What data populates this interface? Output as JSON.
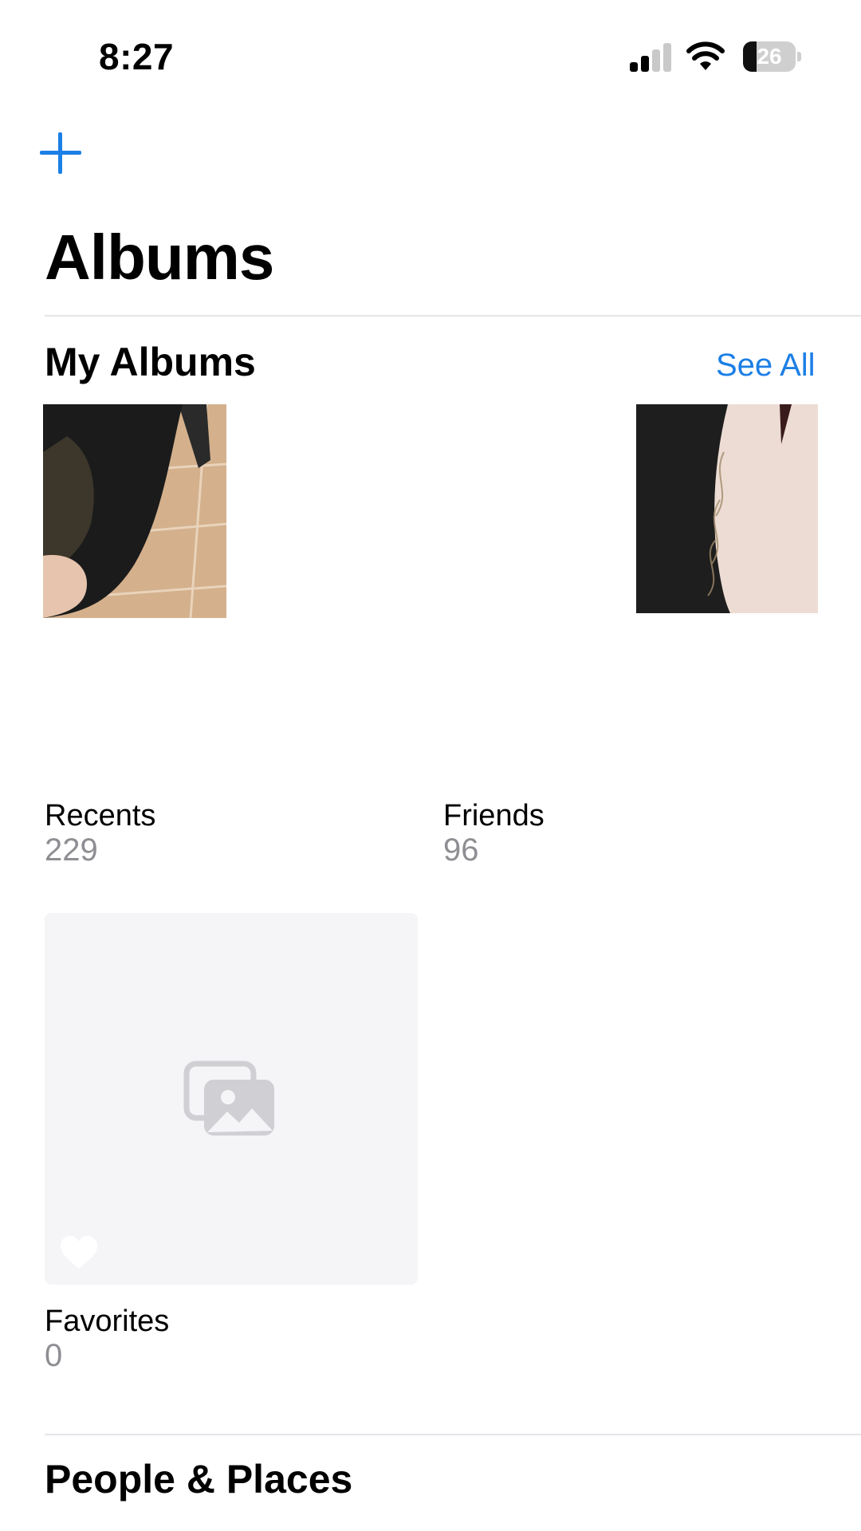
{
  "status_bar": {
    "time": "8:27",
    "battery_level": "26",
    "battery_fraction": 0.26
  },
  "header": {
    "title": "Albums",
    "add_icon": "plus-icon"
  },
  "my_albums": {
    "title": "My Albums",
    "see_all": "See All",
    "albums": [
      {
        "name": "Recents",
        "count": "229"
      },
      {
        "name": "Friends",
        "count": "96"
      },
      {
        "name": "Favorites",
        "count": "0"
      }
    ]
  },
  "next_section": {
    "title": "People & Places"
  },
  "colors": {
    "accent": "#1c7fe6",
    "secondary_text": "#8e8e93",
    "placeholder_bg": "#f5f5f7"
  }
}
